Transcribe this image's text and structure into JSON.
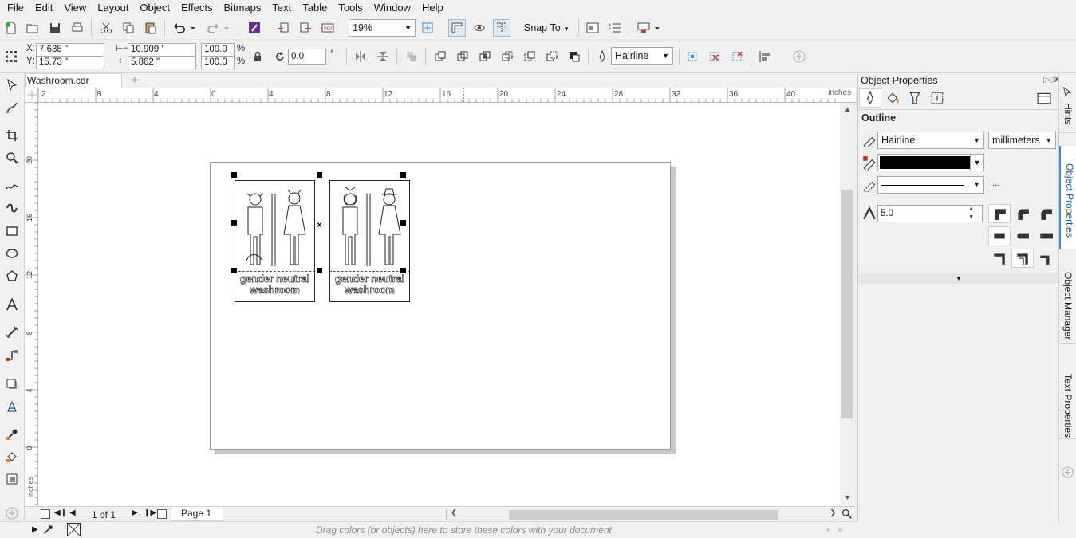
{
  "menu": [
    "File",
    "Edit",
    "View",
    "Layout",
    "Object",
    "Effects",
    "Bitmaps",
    "Text",
    "Table",
    "Tools",
    "Window",
    "Help"
  ],
  "toolbar": {
    "zoom_value": "19%",
    "snap_label": "Snap To"
  },
  "props": {
    "x_label": "X:",
    "x_value": "7.635 \"",
    "y_label": "Y:",
    "y_value": "15.73 \"",
    "w_value": "10.909 \"",
    "h_value": "5.862 \"",
    "sx_value": "100.0",
    "sy_value": "100.0",
    "pct": "%",
    "angle_value": "0.0",
    "deg": "°",
    "outline_value": "Hairline"
  },
  "doc": {
    "tab_label": "Washroom.cdr"
  },
  "ruler": {
    "h_ticks": [
      "2",
      "8",
      "4",
      "0",
      "4",
      "8",
      "12",
      "16",
      "20",
      "24",
      "28",
      "32",
      "36",
      "40"
    ],
    "v_ticks": [
      "20",
      "16",
      "12",
      "8",
      "4",
      "0"
    ],
    "unit": "inches"
  },
  "signs": [
    {
      "line1": "gender neutral",
      "line2": "washroom"
    },
    {
      "line1": "gender neutral",
      "line2": "washroom"
    }
  ],
  "pager": {
    "page_count": "1 of 1",
    "page_tab": "Page 1"
  },
  "status": {
    "hint": "Drag colors (or objects) here to store these colors with your document"
  },
  "panel": {
    "title": "Object Properties",
    "section": "Outline",
    "width_value": "Hairline",
    "units_value": "millimeters",
    "miter_value": "5.0",
    "more": "..."
  },
  "dock": {
    "tabs": [
      "Hints",
      "Object Properties",
      "Object Manager",
      "Text Properties"
    ]
  },
  "colors": {
    "accent": "#3c8fcf",
    "selection": "#000000"
  }
}
